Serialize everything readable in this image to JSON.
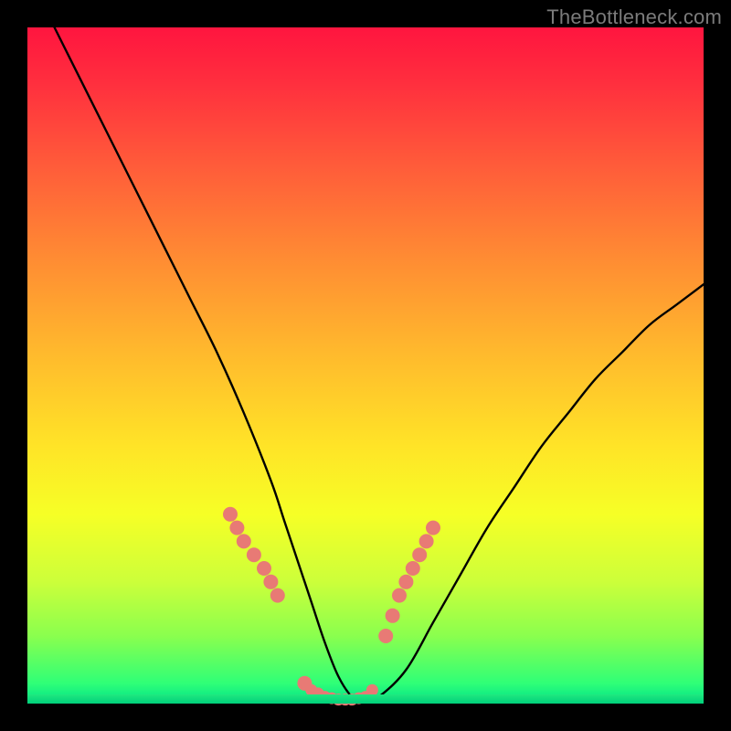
{
  "watermark": "TheBottleneck.com",
  "chart_data": {
    "type": "line",
    "title": "",
    "xlabel": "",
    "ylabel": "",
    "xlim": [
      0,
      100
    ],
    "ylim": [
      0,
      100
    ],
    "grid": false,
    "legend": false,
    "series": [
      {
        "name": "bottleneck-curve",
        "x": [
          4,
          8,
          12,
          16,
          20,
          24,
          28,
          32,
          36,
          38,
          40,
          42,
          44,
          46,
          48,
          50,
          52,
          56,
          60,
          64,
          68,
          72,
          76,
          80,
          84,
          88,
          92,
          96,
          100
        ],
        "y": [
          100,
          92,
          84,
          76,
          68,
          60,
          52,
          43,
          33,
          27,
          21,
          15,
          9,
          4,
          1,
          0,
          1,
          5,
          12,
          19,
          26,
          32,
          38,
          43,
          48,
          52,
          56,
          59,
          62
        ]
      }
    ],
    "markers": {
      "name": "highlight-points",
      "color": "#e87a75",
      "x": [
        30,
        31,
        32,
        33.5,
        35,
        36,
        37,
        41,
        42,
        43,
        44,
        45,
        46,
        47,
        48,
        49,
        50,
        51,
        53,
        54,
        55,
        56,
        57,
        58,
        59,
        60
      ],
      "y": [
        28,
        26,
        24,
        22,
        20,
        18,
        16,
        3,
        2,
        1.5,
        1,
        0.8,
        0.6,
        0.6,
        0.6,
        0.8,
        1,
        2,
        10,
        13,
        16,
        18,
        20,
        22,
        24,
        26
      ]
    },
    "background_gradient": {
      "direction": "top-to-bottom",
      "stops": [
        {
          "pos": 0,
          "color": "#ff153f"
        },
        {
          "pos": 20,
          "color": "#ff5a3a"
        },
        {
          "pos": 48,
          "color": "#ffb92d"
        },
        {
          "pos": 72,
          "color": "#f6ff26"
        },
        {
          "pos": 90,
          "color": "#8aff4e"
        },
        {
          "pos": 100,
          "color": "#00d07b"
        }
      ]
    }
  }
}
